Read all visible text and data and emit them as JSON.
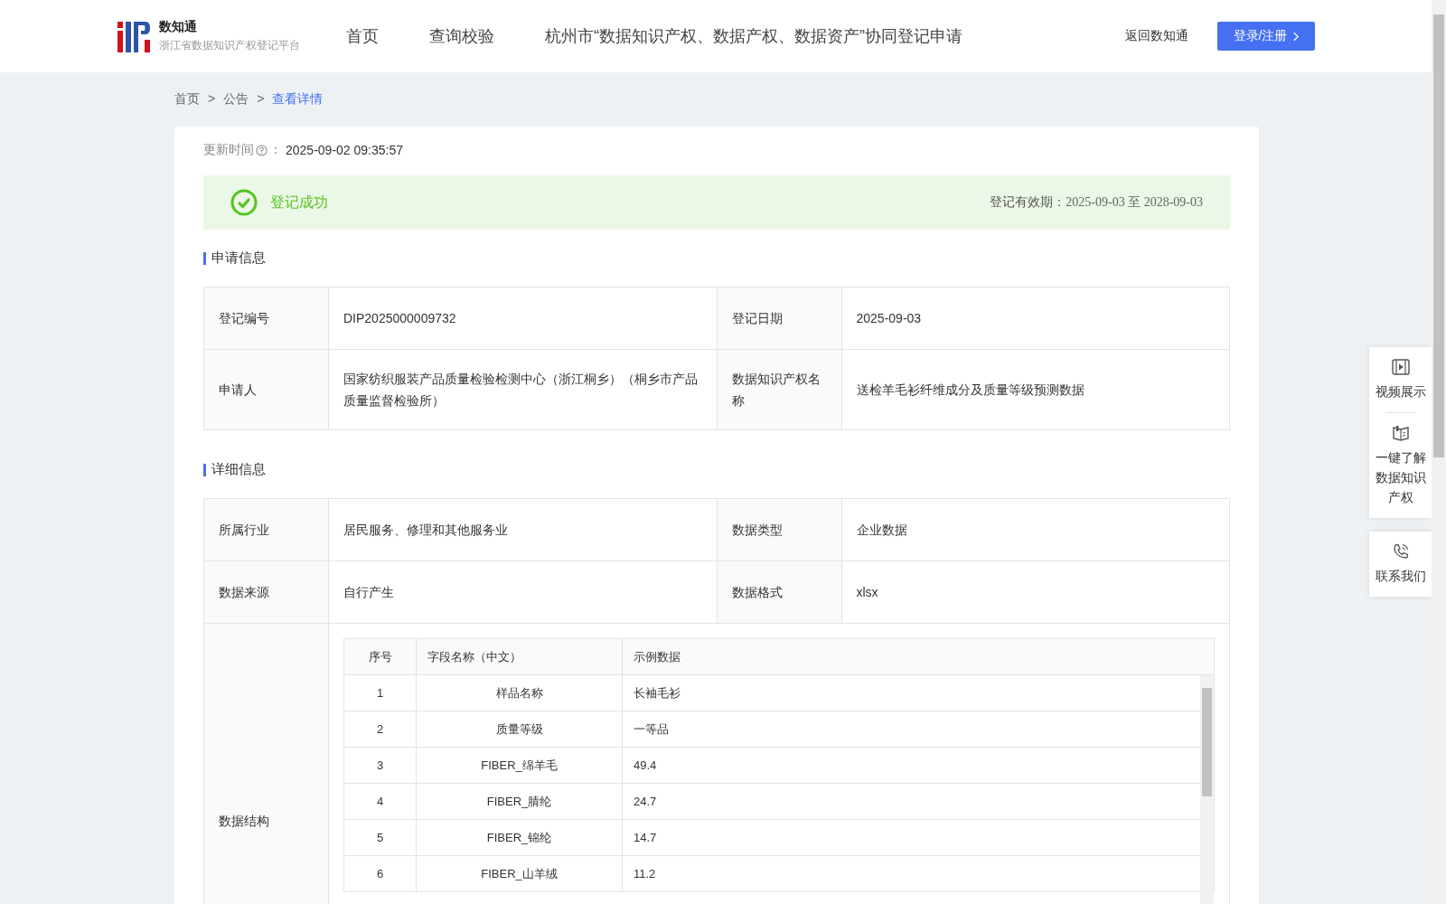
{
  "header": {
    "logo_title": "数知通",
    "logo_subtitle": "浙江省数据知识产权登记平台",
    "nav": [
      {
        "label": "首页"
      },
      {
        "label": "查询校验"
      },
      {
        "label": "杭州市“数据知识产权、数据产权、数据资产”协同登记申请"
      }
    ],
    "back_link": "返回数知通",
    "login_button": "登录/注册"
  },
  "breadcrumb": {
    "separator": ">",
    "items": [
      {
        "label": "首页",
        "selected": false
      },
      {
        "label": "公告",
        "selected": false
      },
      {
        "label": "查看详情",
        "selected": true
      }
    ]
  },
  "update_time": {
    "label": "更新时间",
    "separator": "：",
    "value": "2025-09-02 09:35:57"
  },
  "status": {
    "text": "登记成功",
    "validity_label": "登记有效期：",
    "validity_value": "2025-09-03 至 2028-09-03"
  },
  "sections": [
    {
      "title": "申请信息",
      "rows": [
        [
          {
            "label": "登记编号",
            "value": "DIP2025000009732"
          },
          {
            "label": "登记日期",
            "value": "2025-09-03"
          }
        ],
        [
          {
            "label": "申请人",
            "value": "国家纺织服装产品质量检验检测中心（浙江桐乡）（桐乡市产品质量监督检验所）"
          },
          {
            "label": "数据知识产权名称",
            "value": "送检羊毛衫纤维成分及质量等级预测数据"
          }
        ]
      ]
    },
    {
      "title": "详细信息",
      "rows": [
        [
          {
            "label": "所属行业",
            "value": "居民服务、修理和其他服务业"
          },
          {
            "label": "数据类型",
            "value": "企业数据"
          }
        ],
        [
          {
            "label": "数据来源",
            "value": "自行产生"
          },
          {
            "label": "数据格式",
            "value": "xlsx"
          }
        ]
      ],
      "structure": {
        "label": "数据结构",
        "columns": [
          "序号",
          "字段名称（中文）",
          "示例数据"
        ],
        "rows": [
          [
            "1",
            "样品名称",
            "长袖毛衫"
          ],
          [
            "2",
            "质量等级",
            "一等品"
          ],
          [
            "3",
            "FIBER_绵羊毛",
            "49.4"
          ],
          [
            "4",
            "FIBER_腈纶",
            "24.7"
          ],
          [
            "5",
            "FIBER_锦纶",
            "14.7"
          ],
          [
            "6",
            "FIBER_山羊绒",
            "11.2"
          ]
        ]
      }
    }
  ],
  "side_panel": [
    {
      "kind": "video",
      "label": "视频展示"
    },
    {
      "kind": "book",
      "label": "一键了解数据知识产权"
    },
    {
      "kind": "phone",
      "label": "联系我们"
    }
  ]
}
